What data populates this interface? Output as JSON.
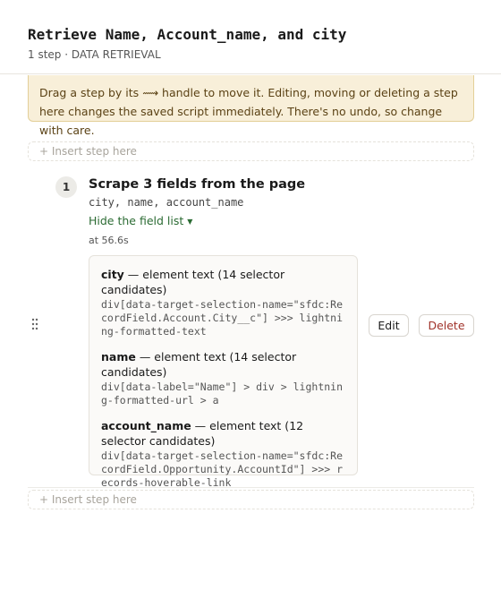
{
  "header": {
    "title": "Retrieve Name, Account_name, and city",
    "subtitle": "1 step · DATA RETRIEVAL"
  },
  "warning": {
    "text": "Drag a step by its ⟿ handle to move it. Editing, moving or deleting a step here changes the saved script immediately. There's no undo, so change with care."
  },
  "insert_label": "+ Insert step here",
  "step": {
    "number": "1",
    "title": "Scrape 3 fields from the page",
    "fields_summary": "city, name, account_name",
    "toggle_label": "Hide the field list",
    "toggle_caret": "▼",
    "timestamp": "at 56.6s",
    "edit_label": "Edit",
    "delete_label": "Delete",
    "fields": [
      {
        "name": "city",
        "desc": " — element text (14 selector candidates)",
        "selector": "div[data-target-selection-name=\"sfdc:RecordField.Account.City__c\"] >>> lightning-formatted-text"
      },
      {
        "name": "name",
        "desc": " — element text (14 selector candidates)",
        "selector": "div[data-label=\"Name\"] > div > lightning-formatted-url > a"
      },
      {
        "name": "account_name",
        "desc": " — element text (12 selector candidates)",
        "selector": "div[data-target-selection-name=\"sfdc:RecordField.Opportunity.AccountId\"] >>> records-hoverable-link"
      }
    ]
  },
  "colors": {
    "warning_bg": "#f8efd9",
    "warning_text": "#5b4215",
    "toggle": "#2b6b33",
    "delete": "#a0322a"
  },
  "icons": {
    "drag": "drag-handle-icon",
    "caret": "caret-down-icon"
  }
}
